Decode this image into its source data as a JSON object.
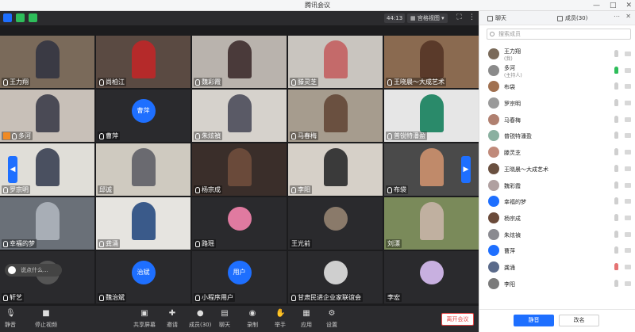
{
  "window": {
    "title": "腾讯会议"
  },
  "topbar": {
    "timer": "44:13",
    "view_mode": "宫格视图"
  },
  "grid": {
    "tiles": [
      {
        "name": "王力翔",
        "type": "video",
        "bg": "#7a6a5a",
        "fg": "#3a3a44"
      },
      {
        "name": "尚柏江",
        "type": "video",
        "bg": "#5a4a42",
        "fg": "#b52a2a"
      },
      {
        "name": "魏彩霞",
        "type": "video",
        "bg": "#b9b3ad",
        "fg": "#4a3a3a"
      },
      {
        "name": "滕灵芝",
        "type": "video",
        "bg": "#c9c5bf",
        "fg": "#c46a6a"
      },
      {
        "name": "王晓晨～大成艺术",
        "type": "video",
        "bg": "#8a6a50",
        "fg": "#5a3a2a"
      },
      {
        "name": "多河",
        "type": "video",
        "bg": "#c8c0b8",
        "fg": "#4a4a55",
        "host": true,
        "active": true
      },
      {
        "name": "曹萍",
        "type": "avatar",
        "avatar_text": "曹萍",
        "avatar_color": "#1e6fff"
      },
      {
        "name": "朱炫禎",
        "type": "video",
        "bg": "#d6d2cc",
        "fg": "#5a5a66"
      },
      {
        "name": "马春梅",
        "type": "video",
        "bg": "#a69c8e",
        "fg": "#6a5040"
      },
      {
        "name": "普锐特潘盈",
        "type": "video",
        "bg": "#e6e6e6",
        "fg": "#2a8a6a"
      },
      {
        "name": "罗宗明",
        "type": "video",
        "bg": "#e0ded8",
        "fg": "#4a5060"
      },
      {
        "name": "邱诚",
        "type": "video",
        "bg": "#cfcac0",
        "fg": "#6a6a70",
        "nomic": true
      },
      {
        "name": "杨宗成",
        "type": "video",
        "bg": "#3a2e2a",
        "fg": "#6a4a3a"
      },
      {
        "name": "李阳",
        "type": "video",
        "bg": "#d6d0c8",
        "fg": "#3a3a3a"
      },
      {
        "name": "布袋",
        "type": "video",
        "bg": "#4a4a4a",
        "fg": "#c08a6a"
      },
      {
        "name": "幸福的梦",
        "type": "video",
        "bg": "#6a7078",
        "fg": "#a8aeb6"
      },
      {
        "name": "龚涌",
        "type": "video",
        "bg": "#e6e4e0",
        "fg": "#3a5a8a"
      },
      {
        "name": "路瑶",
        "type": "avatar",
        "avatar_text": "",
        "avatar_color": "#e07aa0"
      },
      {
        "name": "王光前",
        "type": "avatar",
        "avatar_text": "",
        "avatar_color": "#8a7a6a",
        "nomic": true
      },
      {
        "name": "刘漂",
        "type": "video",
        "bg": "#7a8a5a",
        "fg": "#c0b0a0",
        "nomic": true
      },
      {
        "name": "轩艺",
        "type": "avatar",
        "avatar_text": "",
        "avatar_color": "#555555"
      },
      {
        "name": "魏治斌",
        "type": "avatar",
        "avatar_text": "治斌",
        "avatar_color": "#1e6fff"
      },
      {
        "name": "小程序用户",
        "type": "avatar",
        "avatar_text": "用户",
        "avatar_color": "#1e6fff"
      },
      {
        "name": "甘肃民进企业家联谊会",
        "type": "avatar",
        "avatar_text": "",
        "avatar_color": "#cfcfcf"
      },
      {
        "name": "李宏",
        "type": "avatar",
        "avatar_text": "",
        "avatar_color": "#c8b0e0",
        "nomic": true
      }
    ],
    "chat_hint": "说点什么..."
  },
  "toolbar": {
    "mute": "静音",
    "stop_video": "停止视频",
    "share": "共享屏幕",
    "invite": "邀请",
    "members": "成员(30)",
    "chat": "聊天",
    "record": "录制",
    "hand": "举手",
    "apps": "应用",
    "settings": "设置",
    "end": "离开会议"
  },
  "sidebar": {
    "tab_chat": "聊天",
    "tab_members": "成员(30)",
    "search_placeholder": "搜索成员",
    "members": [
      {
        "name": "王力翔",
        "role": "(我)",
        "color": "#7a6a5a",
        "mic": "idle"
      },
      {
        "name": "多河",
        "role": "(主持人)",
        "color": "#8a8a8a",
        "mic": "on"
      },
      {
        "name": "布袋",
        "role": "",
        "color": "#a07050",
        "mic": "idle"
      },
      {
        "name": "罗宗明",
        "role": "",
        "color": "#9a9a9a",
        "mic": "idle"
      },
      {
        "name": "马春梅",
        "role": "",
        "color": "#b08070",
        "mic": "idle"
      },
      {
        "name": "普锐特潘盈",
        "role": "",
        "color": "#8ab0a0",
        "mic": "idle"
      },
      {
        "name": "滕灵芝",
        "role": "",
        "color": "#c08a7a",
        "mic": "idle"
      },
      {
        "name": "王晓晨～大成艺术",
        "role": "",
        "color": "#6a5040",
        "mic": "idle"
      },
      {
        "name": "魏彩霞",
        "role": "",
        "color": "#b0a0a0",
        "mic": "idle"
      },
      {
        "name": "幸福的梦",
        "role": "",
        "color": "#1e6fff",
        "mic": "idle"
      },
      {
        "name": "杨宗成",
        "role": "",
        "color": "#6a4a3a",
        "mic": "idle"
      },
      {
        "name": "朱炫禎",
        "role": "",
        "color": "#8a8a90",
        "mic": "idle"
      },
      {
        "name": "曹萍",
        "role": "",
        "color": "#1e6fff",
        "mic": "idle"
      },
      {
        "name": "龚涌",
        "role": "",
        "color": "#5a6a8a",
        "mic": "off"
      },
      {
        "name": "李阳",
        "role": "",
        "color": "#7a7a7a",
        "mic": "idle"
      }
    ],
    "mute_all": "静音",
    "rename": "改名"
  }
}
